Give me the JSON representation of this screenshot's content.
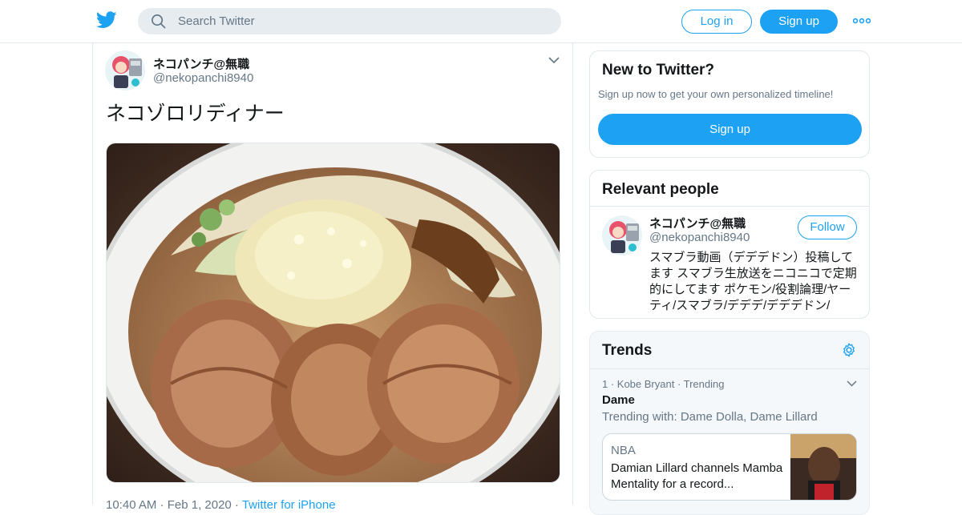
{
  "header": {
    "logo_icon": "twitter-bird-icon",
    "search": {
      "placeholder": "Search Twitter",
      "value": ""
    },
    "login_label": "Log in",
    "signup_label": "Sign up",
    "more_icon": "more-dots-icon",
    "accent": "#1da1f2"
  },
  "tweet": {
    "author_name": "ネコパンチ@無職",
    "author_handle": "@nekopanchi8940",
    "text": "ネコゾロリディナー",
    "photo_subject": "ramen-bowl-photo",
    "time_date": "10:40 AM · Feb 1, 2020 · ",
    "source": "Twitter for iPhone"
  },
  "sidebar": {
    "new_to_twitter": {
      "title": "New to Twitter?",
      "subtitle": "Sign up now to get your own personalized timeline!",
      "signup_label": "Sign up"
    },
    "relevant_people": {
      "title": "Relevant people",
      "name": "ネコパンチ@無職",
      "handle": "@nekopanchi8940",
      "follow_label": "Follow",
      "bio": "スマブラ動画（デデデドン）投稿してます スマブラ生放送をニコニコで定期的にしてます ポケモン/役割論理/ヤーティ/スマブラ/デデデ/デデデドン/"
    },
    "trends": {
      "title": "Trends",
      "settings_icon": "gear-icon",
      "item": {
        "meta": "1 · Kobe Bryant · Trending",
        "name": "Dame",
        "trending_with": "Trending with: Dame Dolla, Dame Lillard",
        "news_category": "NBA",
        "news_headline": "Damian Lillard channels Mamba Mentality for a record..."
      }
    }
  }
}
